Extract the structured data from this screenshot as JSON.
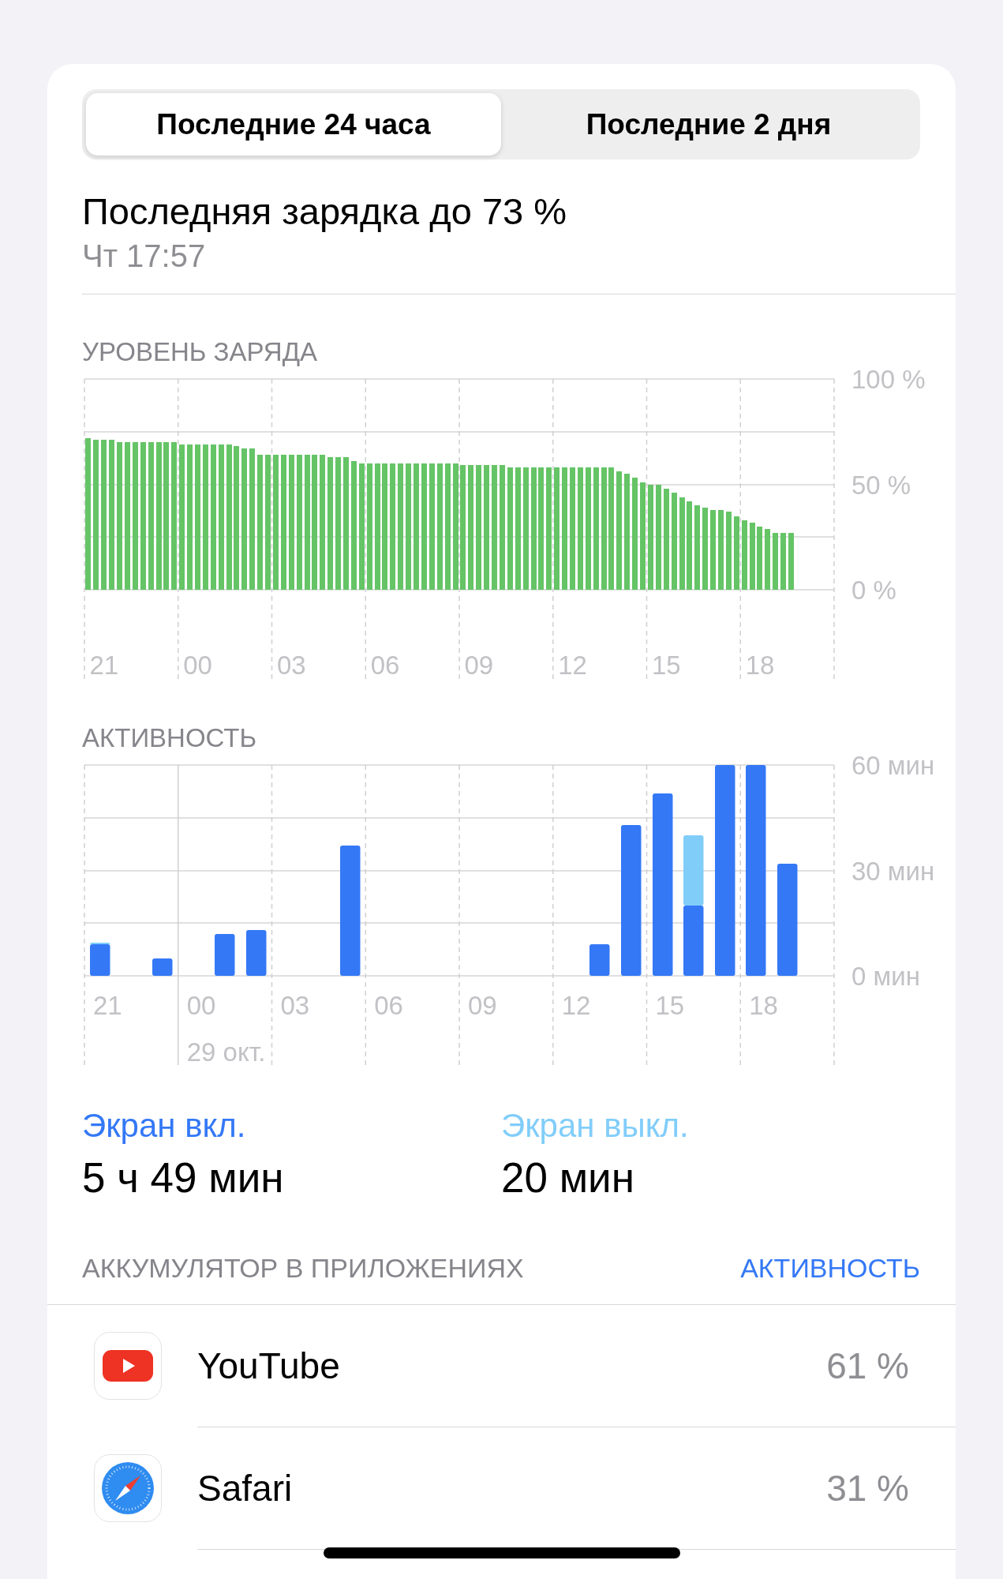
{
  "segments": [
    {
      "label": "Последние 24 часа",
      "selected": true
    },
    {
      "label": "Последние 2 дня",
      "selected": false
    }
  ],
  "last_charge": {
    "title": "Последняя зарядка до 73 %",
    "time": "Чт 17:57"
  },
  "battery_level": {
    "chart_data": {
      "type": "bar",
      "title": "УРОВЕНЬ ЗАРЯДА",
      "ylim": [
        0,
        100
      ],
      "categories": [
        null,
        null,
        "21",
        null,
        null,
        null,
        null,
        null,
        null,
        null,
        null,
        null,
        null,
        null,
        "00",
        null,
        null,
        null,
        null,
        null,
        null,
        null,
        null,
        null,
        null,
        null,
        "03",
        null,
        null,
        null,
        null,
        null,
        null,
        null,
        null,
        null,
        null,
        null,
        "06",
        null,
        null,
        null,
        null,
        null,
        null,
        null,
        null,
        null,
        null,
        null,
        "09",
        null,
        null,
        null,
        null,
        null,
        null,
        null,
        null,
        null,
        null,
        null,
        "12",
        null,
        null,
        null,
        null,
        null,
        null,
        null,
        null,
        null,
        null,
        null,
        "15",
        null,
        null,
        null,
        null,
        null,
        null,
        null,
        null,
        null,
        null,
        null,
        "18",
        null,
        null,
        null,
        null,
        null,
        null,
        null,
        null,
        null
      ],
      "values": [
        72,
        71,
        71,
        71,
        70,
        70,
        70,
        70,
        70,
        70,
        70,
        70,
        69,
        69,
        69,
        69,
        69,
        69,
        69,
        68,
        67,
        67,
        64,
        64,
        64,
        64,
        64,
        64,
        64,
        64,
        64,
        63,
        63,
        63,
        61,
        60,
        60,
        60,
        60,
        60,
        60,
        60,
        60,
        60,
        60,
        60,
        60,
        60,
        59,
        59,
        59,
        59,
        59,
        59,
        58,
        58,
        58,
        58,
        58,
        58,
        58,
        58,
        58,
        58,
        58,
        58,
        58,
        58,
        56,
        55,
        53,
        51,
        50,
        50,
        48,
        46,
        44,
        42,
        40,
        39,
        38,
        38,
        37,
        35,
        33,
        32,
        30,
        29,
        27,
        27,
        27,
        null,
        null,
        null,
        null,
        null
      ],
      "yticks": [
        {
          "value": 0,
          "label": "0 %"
        },
        {
          "value": 50,
          "label": "50 %"
        },
        {
          "value": 100,
          "label": "100 %"
        }
      ]
    }
  },
  "activity": {
    "chart_data": {
      "type": "bar",
      "title": "АКТИВНОСТЬ",
      "stacked": true,
      "ylim": [
        0,
        60
      ],
      "categories": [
        "21",
        null,
        null,
        "00",
        null,
        null,
        "03",
        null,
        null,
        "06",
        null,
        null,
        "09",
        null,
        null,
        "12",
        null,
        null,
        "15",
        null,
        null,
        "18",
        null,
        null
      ],
      "series": [
        {
          "name": "Экран вкл.",
          "color": "#3478f6",
          "values": [
            9,
            0,
            5,
            0,
            12,
            13,
            0,
            0,
            37,
            0,
            0,
            0,
            0,
            0,
            0,
            0,
            9,
            43,
            52,
            20,
            60,
            60,
            32,
            null
          ]
        },
        {
          "name": "Экран выкл.",
          "color": "#81cdfa",
          "values": [
            0.5,
            0,
            0,
            0,
            0,
            0,
            0,
            0,
            0,
            0,
            0,
            0,
            0,
            0,
            0,
            0,
            0,
            0,
            0,
            20,
            0,
            0,
            0,
            null
          ]
        }
      ],
      "yticks": [
        {
          "value": 0,
          "label": "0 мин"
        },
        {
          "value": 30,
          "label": "30 мин"
        },
        {
          "value": 60,
          "label": "60 мин"
        }
      ],
      "annotations": [
        "29 окт."
      ]
    }
  },
  "screen_time": [
    {
      "value": "5 ч 49 мин"
    },
    {
      "value": "20 мин"
    }
  ],
  "apps_header": {
    "title": "АККУМУЛЯТОР В ПРИЛОЖЕНИЯХ",
    "action": "АКТИВНОСТЬ"
  },
  "apps": [
    {
      "name": "YouTube",
      "percent": "61 %",
      "kind": "youtube"
    },
    {
      "name": "Safari",
      "percent": "31 %",
      "kind": "safari"
    }
  ]
}
